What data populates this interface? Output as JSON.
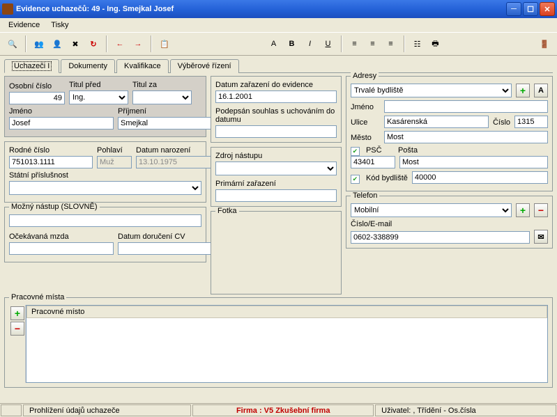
{
  "window": {
    "title": "Evidence uchazečů: 49 - Ing. Smejkal Josef"
  },
  "menu": {
    "evidence": "Evidence",
    "tisky": "Tisky"
  },
  "tabs": {
    "t0": "Uchazeči I",
    "t1": "Dokumenty",
    "t2": "Kvalifikace",
    "t3": "Výběrové řízení"
  },
  "personal": {
    "osobni_cislo_lbl": "Osobní číslo",
    "osobni_cislo": "49",
    "titul_pred_lbl": "Titul před",
    "titul_pred": "Ing.",
    "titul_za_lbl": "Titul za",
    "titul_za": "",
    "jmeno_lbl": "Jméno",
    "jmeno": "Josef",
    "prijmeni_lbl": "Příjmení",
    "prijmeni": "Smejkal"
  },
  "rodne": {
    "rodne_cislo_lbl": "Rodné číslo",
    "rodne_cislo": "751013.1111",
    "pohlavi_lbl": "Pohlaví",
    "pohlavi": "Muž",
    "datum_nar_lbl": "Datum narození",
    "datum_nar": "13.10.1975",
    "statni_lbl": "Státní příslušnost",
    "statni": ""
  },
  "nastup": {
    "legend": "Možný nástup  (SLOVNĚ)",
    "value": "",
    "ocekavana_lbl": "Očekávaná mzda",
    "ocekavana": "",
    "datum_cv_lbl": "Datum doručení CV",
    "datum_cv": ""
  },
  "evidence": {
    "datum_lbl": "Datum zařazení do evidence",
    "datum": "16.1.2001",
    "souhlas_lbl": "Podepsán souhlas s uchováním do datumu",
    "souhlas": "",
    "zdroj_lbl": "Zdroj nástupu",
    "zdroj": "",
    "primarni_lbl": "Primární zařazení",
    "primarni": "",
    "fotka_lbl": "Fotka"
  },
  "adresy": {
    "legend": "Adresy",
    "typ": "Trvalé bydliště",
    "jmeno_lbl": "Jméno",
    "jmeno": "",
    "ulice_lbl": "Ulice",
    "ulice": "Kasárenská",
    "cislo_lbl": "Číslo",
    "cislo": "1315",
    "mesto_lbl": "Město",
    "mesto": "Most",
    "psc_lbl": "PSČ",
    "psc": "43401",
    "posta_lbl": "Pošta",
    "posta": "Most",
    "kod_lbl": "Kód bydliště",
    "kod": "40000",
    "a_btn": "A"
  },
  "telefon": {
    "legend": "Telefon",
    "typ": "Mobilní",
    "cislo_lbl": "Číslo/E-mail",
    "cislo": "0602-338899"
  },
  "pracovne": {
    "legend": "Pracovné místa",
    "header": "Pracovné místo"
  },
  "status": {
    "left": "Prohlížení údajů uchazeče",
    "mid": "Firma :  V5 Zkušební firma",
    "right": "Uživatel: , Třídění - Os.čísla"
  }
}
